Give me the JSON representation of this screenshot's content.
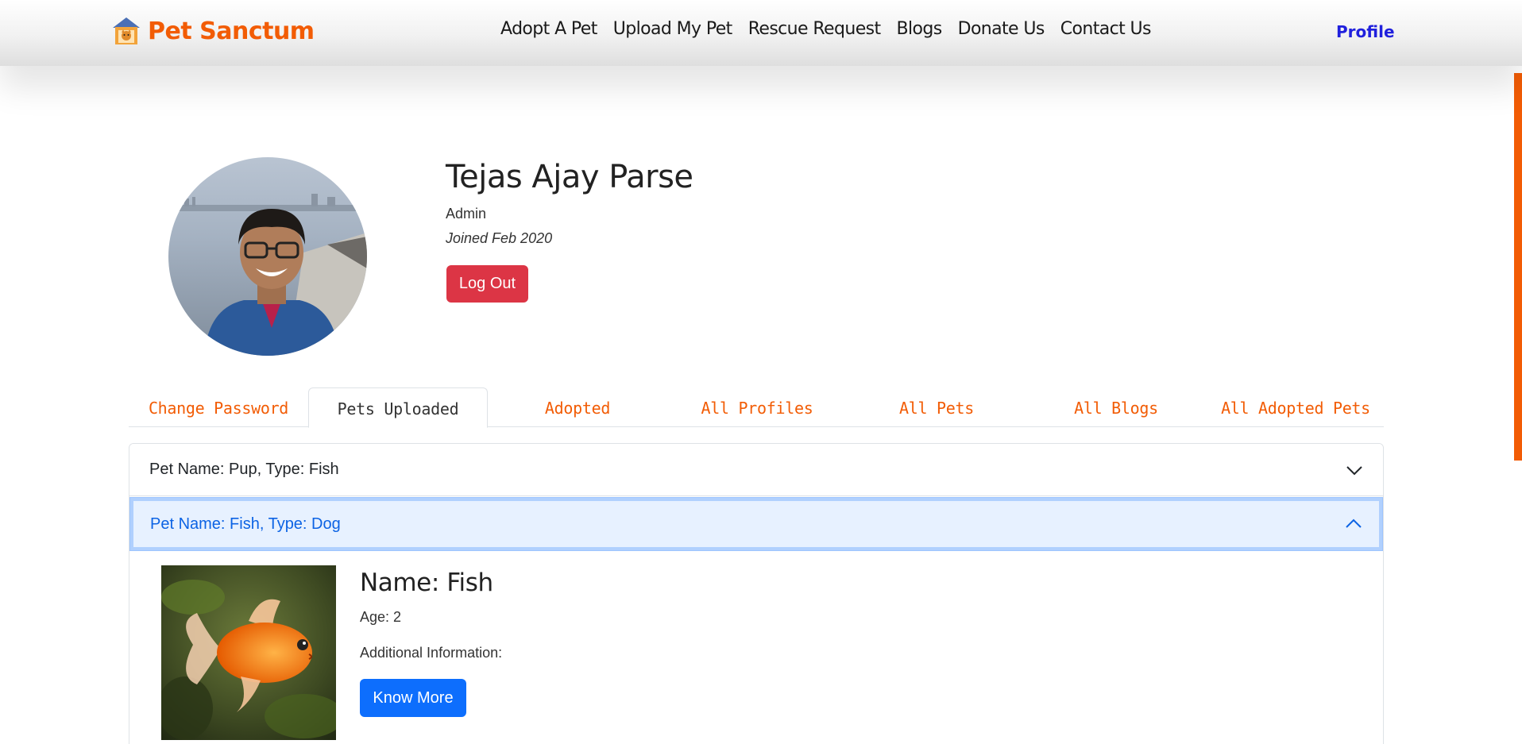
{
  "navbar": {
    "brand": "Pet Sanctum",
    "links": [
      "Adopt A Pet",
      "Upload My Pet",
      "Rescue Request",
      "Blogs",
      "Donate Us",
      "Contact Us"
    ],
    "profile": "Profile"
  },
  "user": {
    "name": "Tejas Ajay Parse",
    "role": "Admin",
    "joined": "Joined Feb 2020",
    "logout_label": "Log Out"
  },
  "tabs": [
    "Change Password",
    "Pets Uploaded",
    "Adopted",
    "All Profiles",
    "All Pets",
    "All Blogs",
    "All Adopted Pets"
  ],
  "active_tab": "Pets Uploaded",
  "accordion": {
    "items": [
      {
        "title": "Pet Name: Pup, Type: Fish",
        "expanded": false
      },
      {
        "title": "Pet Name: Fish, Type: Dog",
        "expanded": true
      }
    ],
    "detail": {
      "name": "Name: Fish",
      "age": "Age: 2",
      "info": "Additional Information:",
      "button": "Know More"
    }
  },
  "colors": {
    "brand": "#f25c05",
    "danger": "#dc3545",
    "primary": "#0d6efd",
    "profile_link": "#2020dd",
    "accordion_active_bg": "#e7f1ff"
  }
}
